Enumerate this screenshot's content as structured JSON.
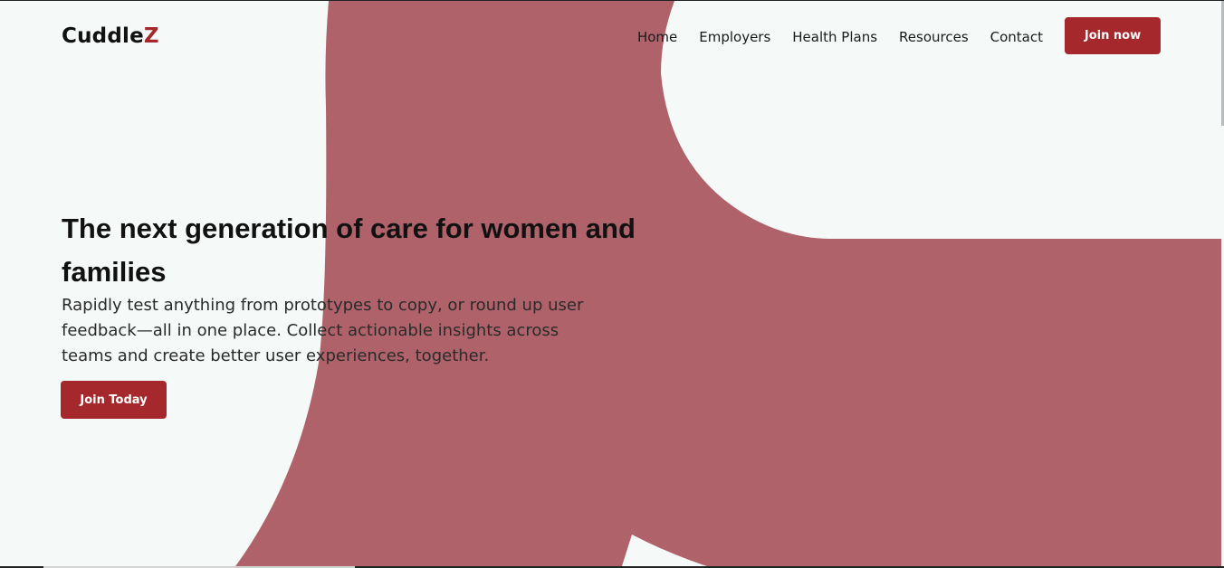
{
  "brand": {
    "name_main": "Cuddle",
    "name_accent": "Z",
    "accent_color": "#a4282c",
    "shape_color": "#b0626a",
    "background_color": "#f5f9f8"
  },
  "nav": {
    "items": [
      "Home",
      "Employers",
      "Health Plans",
      "Resources",
      "Contact"
    ],
    "cta_label": "Join now"
  },
  "hero": {
    "title": "The next generation of care for women and families",
    "subtitle": "Rapidly test anything from prototypes to copy, or round up user feedback—all in one place. Collect actionable insights across teams and create better user experiences, together.",
    "cta_label": "Join Today"
  }
}
